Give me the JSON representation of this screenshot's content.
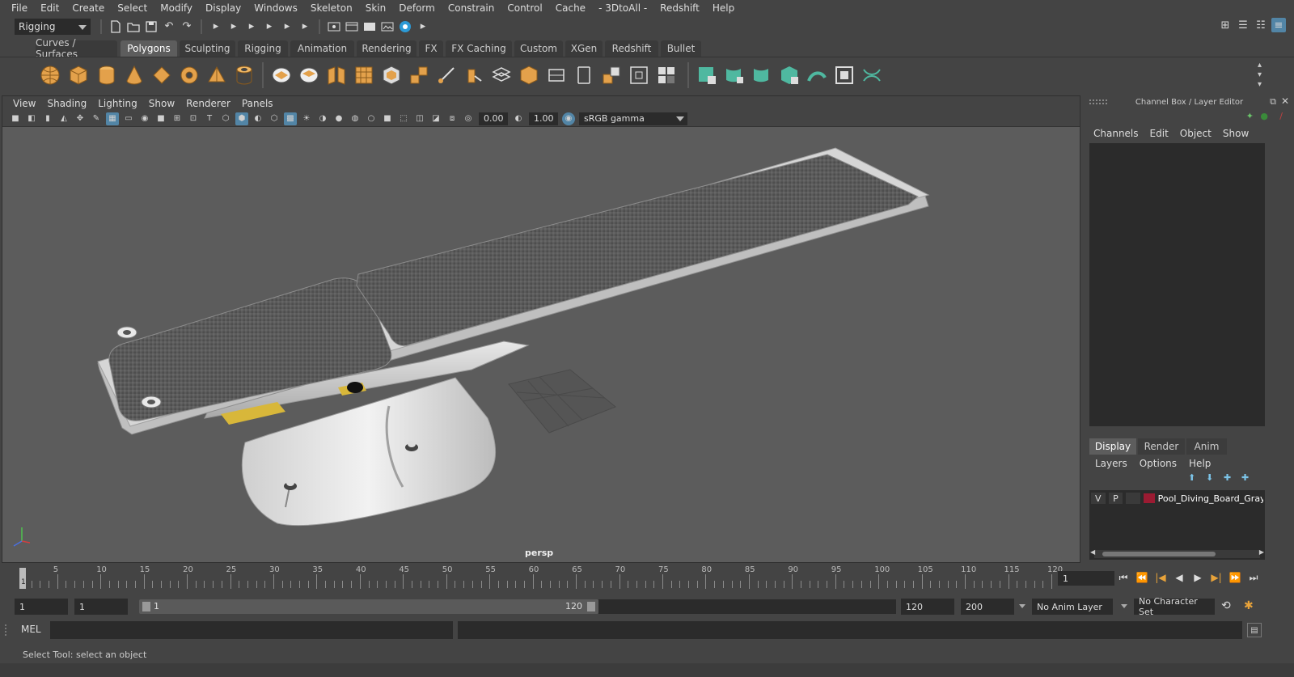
{
  "menubar": {
    "items": [
      "File",
      "Edit",
      "Create",
      "Select",
      "Modify",
      "Display",
      "Windows",
      "Skeleton",
      "Skin",
      "Deform",
      "Constrain",
      "Control",
      "Cache",
      "- 3DtoAll -",
      "Redshift",
      "Help"
    ]
  },
  "statusline": {
    "menuset": "Rigging"
  },
  "shelf": {
    "tabs": [
      "Curves / Surfaces",
      "Polygons",
      "Sculpting",
      "Rigging",
      "Animation",
      "Rendering",
      "FX",
      "FX Caching",
      "Custom",
      "XGen",
      "Redshift",
      "Bullet"
    ],
    "active_tab": "Polygons",
    "accent_color": "#e3a14b",
    "green_color": "#4fb8a0"
  },
  "viewport": {
    "menu": [
      "View",
      "Shading",
      "Lighting",
      "Show",
      "Renderer",
      "Panels"
    ],
    "exposure": "0.00",
    "gamma": "1.00",
    "color_space": "sRGB gamma",
    "camera_label": "persp",
    "background_color": "#5c5c5c"
  },
  "channelbox": {
    "title": "Channel Box / Layer Editor",
    "menu": [
      "Channels",
      "Edit",
      "Object",
      "Show"
    ]
  },
  "layereditor": {
    "tabs": [
      "Display",
      "Render",
      "Anim"
    ],
    "active_tab": "Display",
    "menu": [
      "Layers",
      "Options",
      "Help"
    ],
    "layer": {
      "visible": "V",
      "playback": "P",
      "name": "Pool_Diving_Board_Gray",
      "color": "#9b1b32"
    }
  },
  "timeslider": {
    "ticks": [
      "5",
      "10",
      "15",
      "20",
      "25",
      "30",
      "35",
      "40",
      "45",
      "50",
      "55",
      "60",
      "65",
      "70",
      "75",
      "80",
      "85",
      "90",
      "95",
      "100",
      "105",
      "110",
      "115",
      "120"
    ],
    "start_label": "1",
    "current_frame": "1"
  },
  "rangeslider": {
    "start": "1",
    "anim_start": "1",
    "range_start": "1",
    "range_end": "120",
    "anim_end": "120",
    "end": "200",
    "anim_layer": "No Anim Layer",
    "character_set": "No Character Set"
  },
  "cmdline": {
    "label": "MEL"
  },
  "helpline": {
    "text": "Select Tool: select an object"
  }
}
